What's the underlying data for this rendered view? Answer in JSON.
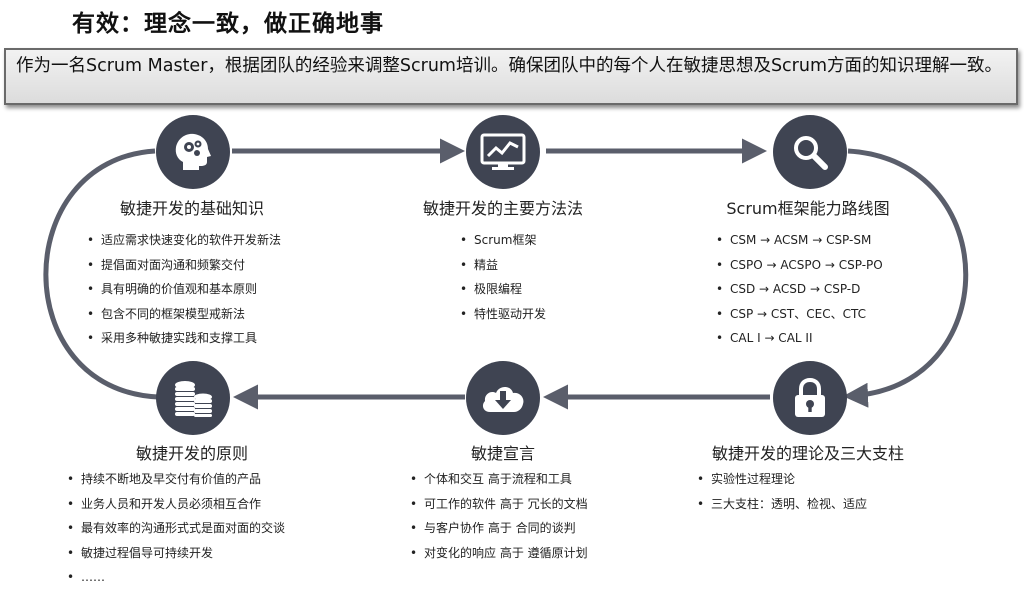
{
  "page": {
    "title": "有效：理念一致，做正确地事",
    "banner": "作为一名Scrum Master，根据团队的经验来调整Scrum培训。确保团队中的每个人在敏捷思想及Scrum方面的知识理解一致。"
  },
  "colors": {
    "node": "#3f4452",
    "loop": "#5a5e6b"
  },
  "nodes": [
    {
      "icon": "head-gears-icon",
      "heading": "敏捷开发的基础知识",
      "items": [
        "适应需求快速变化的软件开发新法",
        "提倡面对面沟通和频繁交付",
        "具有明确的价值观和基本原则",
        "包含不同的框架模型戒新法",
        "采用多种敏捷实践和支撑工具"
      ]
    },
    {
      "icon": "monitor-chart-icon",
      "heading": "敏捷开发的主要方法法",
      "items": [
        "Scrum框架",
        "精益",
        "极限编程",
        "特性驱动开发"
      ]
    },
    {
      "icon": "search-icon",
      "heading": "Scrum框架能力路线图",
      "items": [
        "CSM → ACSM → CSP-SM",
        "CSPO → ACSPO → CSP-PO",
        "CSD → ACSD → CSP-D",
        "CSP → CST、CEC、CTC",
        "CAL I → CAL II"
      ]
    },
    {
      "icon": "coins-icon",
      "heading": "敏捷开发的原则",
      "items": [
        "持续不断地及早交付有价值的产品",
        "业务人员和开发人员必须相互合作",
        "最有效率的沟通形式式是面对面的交谈",
        "敏捷过程倡导可持续开发",
        "……"
      ]
    },
    {
      "icon": "cloud-download-icon",
      "heading": "敏捷宣言",
      "items": [
        "个体和交互 高于流程和工具",
        "可工作的软件 高于 冗长的文档",
        "与客户协作 高于 合同的谈判",
        "对变化的响应 高于 遵循原计划"
      ]
    },
    {
      "icon": "lock-icon",
      "heading": "敏捷开发的理论及三大支柱",
      "items": [
        "实验性过程理论",
        "三大支柱：透明、检视、适应"
      ]
    }
  ]
}
